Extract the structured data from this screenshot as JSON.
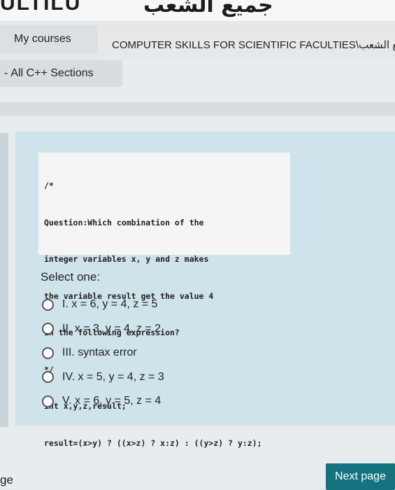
{
  "banner": {
    "arabic_text": "جميع الشعب",
    "fragment_text": "ULTILU"
  },
  "breadcrumb": {
    "my_courses": "My courses",
    "course": "COMPUTER SKILLS FOR SCIENTIFIC FACULTIES\\جميع الشعب",
    "sections": "All C++ Sections",
    "sections_marker": "-"
  },
  "question": {
    "code_lines": [
      "/*",
      "Question:Which combination of the",
      "integer variables x, y and z makes",
      "the variable result get the value 4",
      "in the following expression?",
      "*/",
      "int x,y,z,result;",
      "result=(x>y) ? ((x>z) ? x:z) : ((y>z) ? y:z);"
    ],
    "prompt": "Select one:",
    "options": [
      "I. x = 6, y = 4, z = 5",
      "II. x = 3, y = 4, z = 2",
      "III. syntax error",
      "IV. x = 5, y = 4, z = 3",
      "V. x = 6, y = 5, z = 4"
    ]
  },
  "footer": {
    "left_fragment": "ge",
    "next_label": "Next page"
  }
}
